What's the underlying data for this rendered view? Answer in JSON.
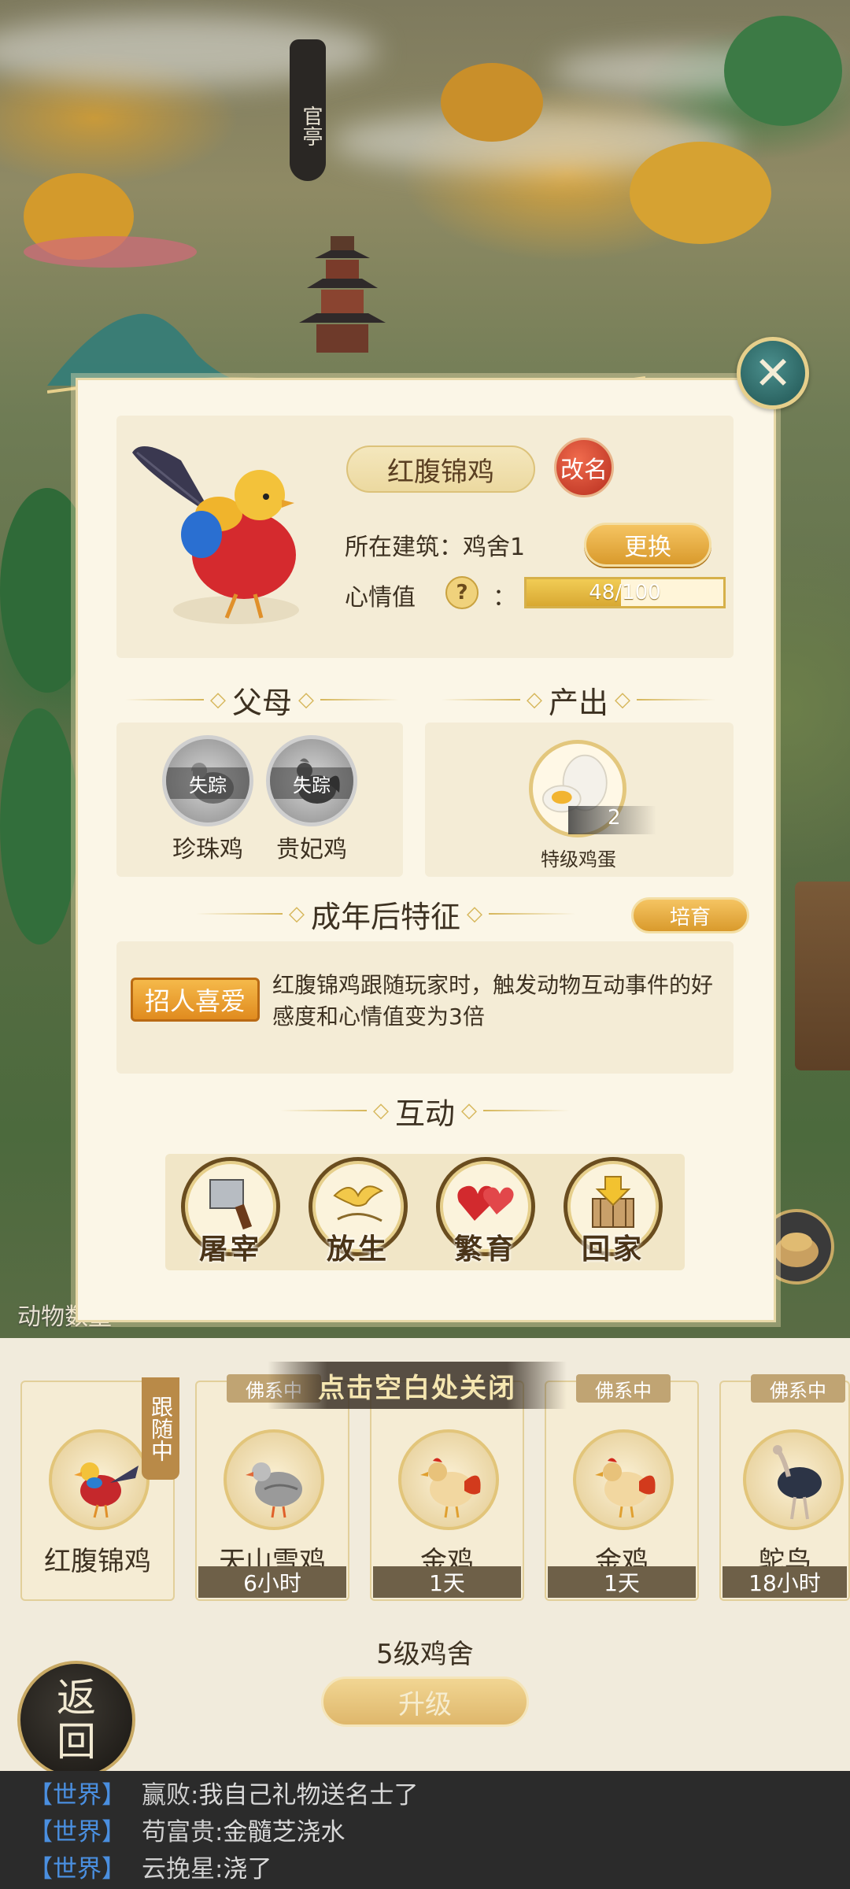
{
  "background": {
    "sign_text": "官亭"
  },
  "animal": {
    "name": "红腹锦鸡",
    "rename_label": "改名",
    "building_label": "所在建筑：鸡舍1",
    "change_label": "更换",
    "mood_label": "心情值",
    "mood_colon": "：",
    "mood_text": "48/100",
    "mood_value": 48,
    "mood_max": 100
  },
  "sections": {
    "parents_title": "父母",
    "output_title": "产出",
    "traits_title": "成年后特征",
    "interact_title": "互动"
  },
  "parents": [
    {
      "name": "珍珠鸡",
      "status": "失踪"
    },
    {
      "name": "贵妃鸡",
      "status": "失踪"
    }
  ],
  "output": {
    "item_name": "特级鸡蛋",
    "count": "2"
  },
  "cultivate_label": "培育",
  "trait": {
    "badge": "招人喜爱",
    "description": "红腹锦鸡跟随玩家时，触发动物互动事件的好感度和心情值变为3倍"
  },
  "actions": [
    {
      "label": "屠宰",
      "icon": "cleaver-icon"
    },
    {
      "label": "放生",
      "icon": "bird-release-icon"
    },
    {
      "label": "繁育",
      "icon": "hearts-icon"
    },
    {
      "label": "回家",
      "icon": "home-arrow-icon"
    }
  ],
  "close_hint": "点击空白处关闭",
  "animal_count_label": "动物数量",
  "follow_tag": "跟随中",
  "animal_list": [
    {
      "name": "红腹锦鸡",
      "time": "",
      "status": ""
    },
    {
      "name": "天山雪鸡",
      "time": "6小时",
      "status": "佛系中"
    },
    {
      "name": "金鸡",
      "time": "1天",
      "status": ""
    },
    {
      "name": "金鸡",
      "time": "1天",
      "status": "佛系中"
    },
    {
      "name": "鸵鸟",
      "time": "18小时",
      "status": "佛系中"
    }
  ],
  "coop": {
    "level_label": "5级鸡舍",
    "upgrade_label": "升级"
  },
  "back_label_1": "返",
  "back_label_2": "回",
  "chat": [
    {
      "channel": "【世界】",
      "user": "赢败:",
      "message": " 我自己礼物送名士了"
    },
    {
      "channel": "【世界】",
      "user": "苟富贵:",
      "message": " 金髓芝浇水"
    },
    {
      "channel": "【世界】",
      "user": "云挽星:",
      "message": " 浇了"
    }
  ],
  "colors": {
    "accent_gold": "#d99a2c",
    "modal_bg": "#fbf6e7",
    "close_teal": "#2c6563",
    "chat_channel": "#4a8fe0"
  }
}
